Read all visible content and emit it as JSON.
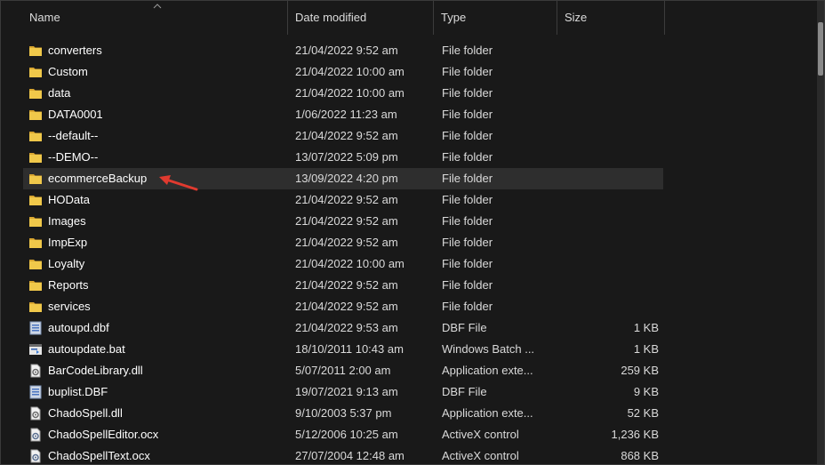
{
  "columns": {
    "name": "Name",
    "date": "Date modified",
    "type": "Type",
    "size": "Size"
  },
  "files": [
    {
      "name": "converters",
      "date": "21/04/2022 9:52 am",
      "type": "File folder",
      "size": "",
      "icon": "folder-icon"
    },
    {
      "name": "Custom",
      "date": "21/04/2022 10:00 am",
      "type": "File folder",
      "size": "",
      "icon": "folder-icon"
    },
    {
      "name": "data",
      "date": "21/04/2022 10:00 am",
      "type": "File folder",
      "size": "",
      "icon": "folder-icon"
    },
    {
      "name": "DATA0001",
      "date": "1/06/2022 11:23 am",
      "type": "File folder",
      "size": "",
      "icon": "folder-icon"
    },
    {
      "name": "--default--",
      "date": "21/04/2022 9:52 am",
      "type": "File folder",
      "size": "",
      "icon": "folder-icon"
    },
    {
      "name": "--DEMO--",
      "date": "13/07/2022 5:09 pm",
      "type": "File folder",
      "size": "",
      "icon": "folder-icon"
    },
    {
      "name": "ecommerceBackup",
      "date": "13/09/2022 4:20 pm",
      "type": "File folder",
      "size": "",
      "icon": "folder-icon"
    },
    {
      "name": "HOData",
      "date": "21/04/2022 9:52 am",
      "type": "File folder",
      "size": "",
      "icon": "folder-icon"
    },
    {
      "name": "Images",
      "date": "21/04/2022 9:52 am",
      "type": "File folder",
      "size": "",
      "icon": "folder-icon"
    },
    {
      "name": "ImpExp",
      "date": "21/04/2022 9:52 am",
      "type": "File folder",
      "size": "",
      "icon": "folder-icon"
    },
    {
      "name": "Loyalty",
      "date": "21/04/2022 10:00 am",
      "type": "File folder",
      "size": "",
      "icon": "folder-icon"
    },
    {
      "name": "Reports",
      "date": "21/04/2022 9:52 am",
      "type": "File folder",
      "size": "",
      "icon": "folder-icon"
    },
    {
      "name": "services",
      "date": "21/04/2022 9:52 am",
      "type": "File folder",
      "size": "",
      "icon": "folder-icon"
    },
    {
      "name": "autoupd.dbf",
      "date": "21/04/2022 9:53 am",
      "type": "DBF File",
      "size": "1 KB",
      "icon": "dbf-file-icon"
    },
    {
      "name": "autoupdate.bat",
      "date": "18/10/2011 10:43 am",
      "type": "Windows Batch ...",
      "size": "1 KB",
      "icon": "batch-file-icon"
    },
    {
      "name": "BarCodeLibrary.dll",
      "date": "5/07/2011 2:00 am",
      "type": "Application exte...",
      "size": "259 KB",
      "icon": "dll-file-icon"
    },
    {
      "name": "buplist.DBF",
      "date": "19/07/2021 9:13 am",
      "type": "DBF File",
      "size": "9 KB",
      "icon": "dbf-file-icon"
    },
    {
      "name": "ChadoSpell.dll",
      "date": "9/10/2003 5:37 pm",
      "type": "Application exte...",
      "size": "52 KB",
      "icon": "dll-file-icon"
    },
    {
      "name": "ChadoSpellEditor.ocx",
      "date": "5/12/2006 10:25 am",
      "type": "ActiveX control",
      "size": "1,236 KB",
      "icon": "ocx-file-icon"
    },
    {
      "name": "ChadoSpellText.ocx",
      "date": "27/07/2004 12:48 am",
      "type": "ActiveX control",
      "size": "868 KB",
      "icon": "ocx-file-icon"
    }
  ],
  "hovered_row": 6,
  "colors": {
    "background": "#191919",
    "hover": "#2e2e2e",
    "folder": "#f0c84a",
    "arrow": "#e03a2f"
  }
}
